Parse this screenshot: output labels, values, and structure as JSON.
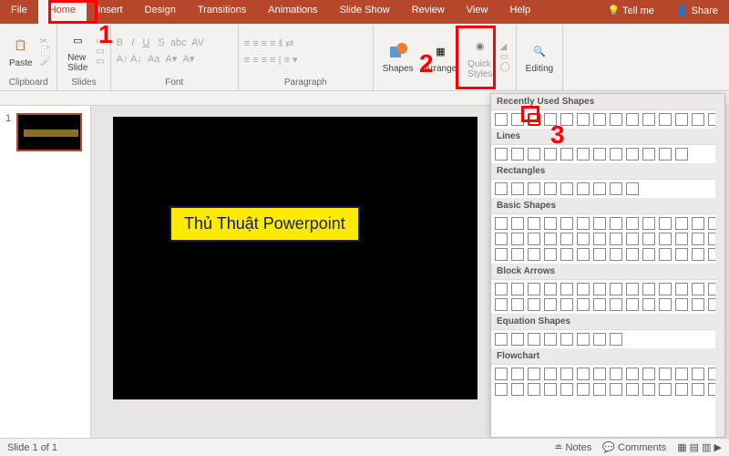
{
  "tabs": {
    "file": "File",
    "home": "Home",
    "insert": "Insert",
    "design": "Design",
    "transitions": "Transitions",
    "animations": "Animations",
    "slideshow": "Slide Show",
    "review": "Review",
    "view": "View",
    "help": "Help",
    "tellme": "Tell me",
    "share": "Share"
  },
  "ribbon": {
    "clipboard": {
      "paste": "Paste",
      "label": "Clipboard"
    },
    "slides": {
      "new": "New\nSlide",
      "label": "Slides"
    },
    "font": {
      "label": "Font"
    },
    "paragraph": {
      "label": "Paragraph"
    },
    "drawing": {
      "shapes": "Shapes",
      "arrange": "Arrange",
      "quick": "Quick\nStyles"
    },
    "editing": {
      "label": "Editing"
    }
  },
  "thumb": {
    "num": "1"
  },
  "caption": "Thủ Thuật Powerpoint",
  "shapes": {
    "recent": "Recently Used Shapes",
    "lines": "Lines",
    "rects": "Rectangles",
    "basic": "Basic Shapes",
    "arrows": "Block Arrows",
    "equation": "Equation Shapes",
    "flow": "Flowchart"
  },
  "status": {
    "slide": "Slide 1 of 1",
    "notes": "Notes",
    "comments": "Comments"
  },
  "annotations": {
    "n1": "1",
    "n2": "2",
    "n3": "3"
  }
}
